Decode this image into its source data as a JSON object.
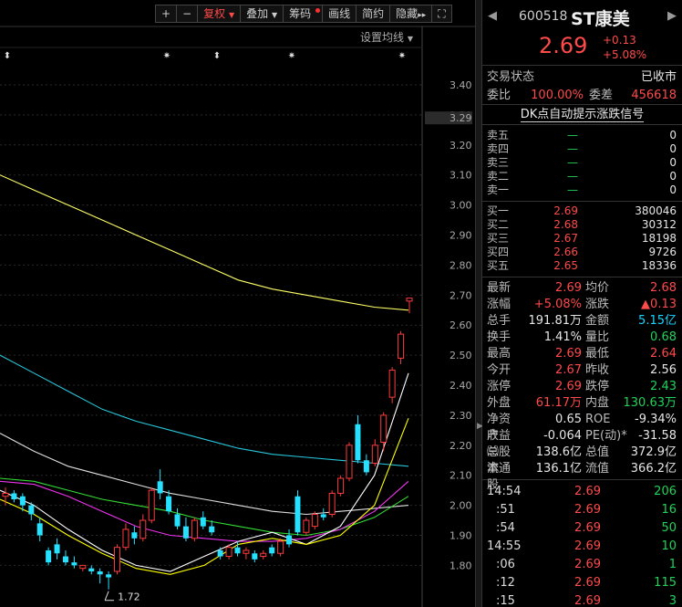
{
  "toolbar": {
    "plus": "+",
    "minus": "−",
    "adjust": "复权",
    "overlay": "叠加",
    "chips": "筹码",
    "draw": "画线",
    "simple": "简约",
    "hide": "隐藏",
    "more": "▸▸",
    "fullscreen": "⛶"
  },
  "ma_setting": "设置均线",
  "chart_data": {
    "type": "candlestick",
    "y_ticks": [
      "3.40",
      "3.30",
      "3.20",
      "3.10",
      "3.00",
      "2.90",
      "2.80",
      "2.70",
      "2.60",
      "2.50",
      "2.40",
      "2.30",
      "2.20",
      "2.10",
      "2.00",
      "1.90",
      "1.80"
    ],
    "ylim": [
      1.75,
      3.45
    ],
    "current_price_label": "3.29",
    "low_label": "1.72",
    "candles": [
      {
        "o": 2.03,
        "h": 2.06,
        "l": 2.0,
        "c": 2.04
      },
      {
        "o": 2.04,
        "h": 2.05,
        "l": 2.01,
        "c": 2.02
      },
      {
        "o": 2.03,
        "h": 2.04,
        "l": 1.98,
        "c": 2.0
      },
      {
        "o": 2.0,
        "h": 2.01,
        "l": 1.95,
        "c": 1.97
      },
      {
        "o": 1.94,
        "h": 1.96,
        "l": 1.88,
        "c": 1.9
      },
      {
        "o": 1.85,
        "h": 1.86,
        "l": 1.8,
        "c": 1.81
      },
      {
        "o": 1.87,
        "h": 1.89,
        "l": 1.82,
        "c": 1.84
      },
      {
        "o": 1.83,
        "h": 1.85,
        "l": 1.8,
        "c": 1.81
      },
      {
        "o": 1.81,
        "h": 1.83,
        "l": 1.79,
        "c": 1.8
      },
      {
        "o": 1.79,
        "h": 1.8,
        "l": 1.78,
        "c": 1.8
      },
      {
        "o": 1.79,
        "h": 1.8,
        "l": 1.77,
        "c": 1.78
      },
      {
        "o": 1.78,
        "h": 1.79,
        "l": 1.74,
        "c": 1.77
      },
      {
        "o": 1.77,
        "h": 1.78,
        "l": 1.72,
        "c": 1.76
      },
      {
        "o": 1.78,
        "h": 1.87,
        "l": 1.77,
        "c": 1.86
      },
      {
        "o": 1.86,
        "h": 1.94,
        "l": 1.85,
        "c": 1.92
      },
      {
        "o": 1.91,
        "h": 1.93,
        "l": 1.87,
        "c": 1.89
      },
      {
        "o": 1.89,
        "h": 1.97,
        "l": 1.88,
        "c": 1.95
      },
      {
        "o": 1.95,
        "h": 2.06,
        "l": 1.94,
        "c": 2.05
      },
      {
        "o": 2.08,
        "h": 2.12,
        "l": 2.02,
        "c": 2.04
      },
      {
        "o": 2.03,
        "h": 2.05,
        "l": 1.97,
        "c": 1.98
      },
      {
        "o": 1.97,
        "h": 1.99,
        "l": 1.92,
        "c": 1.93
      },
      {
        "o": 1.93,
        "h": 1.96,
        "l": 1.88,
        "c": 1.89
      },
      {
        "o": 1.89,
        "h": 1.96,
        "l": 1.88,
        "c": 1.95
      },
      {
        "o": 1.96,
        "h": 1.98,
        "l": 1.92,
        "c": 1.93
      },
      {
        "o": 1.93,
        "h": 1.95,
        "l": 1.9,
        "c": 1.91
      },
      {
        "o": 1.85,
        "h": 1.86,
        "l": 1.82,
        "c": 1.83
      },
      {
        "o": 1.83,
        "h": 1.87,
        "l": 1.82,
        "c": 1.86
      },
      {
        "o": 1.86,
        "h": 1.88,
        "l": 1.83,
        "c": 1.84
      },
      {
        "o": 1.84,
        "h": 1.86,
        "l": 1.82,
        "c": 1.85
      },
      {
        "o": 1.84,
        "h": 1.85,
        "l": 1.81,
        "c": 1.82
      },
      {
        "o": 1.83,
        "h": 1.85,
        "l": 1.82,
        "c": 1.84
      },
      {
        "o": 1.86,
        "h": 1.87,
        "l": 1.83,
        "c": 1.84
      },
      {
        "o": 1.84,
        "h": 1.89,
        "l": 1.83,
        "c": 1.88
      },
      {
        "o": 1.9,
        "h": 1.92,
        "l": 1.86,
        "c": 1.87
      },
      {
        "o": 2.03,
        "h": 2.05,
        "l": 1.9,
        "c": 1.91
      },
      {
        "o": 1.91,
        "h": 1.96,
        "l": 1.9,
        "c": 1.95
      },
      {
        "o": 1.93,
        "h": 1.98,
        "l": 1.92,
        "c": 1.97
      },
      {
        "o": 1.97,
        "h": 1.99,
        "l": 1.95,
        "c": 1.96
      },
      {
        "o": 1.97,
        "h": 2.05,
        "l": 1.96,
        "c": 2.04
      },
      {
        "o": 2.04,
        "h": 2.1,
        "l": 2.03,
        "c": 2.09
      },
      {
        "o": 2.09,
        "h": 2.21,
        "l": 2.08,
        "c": 2.2
      },
      {
        "o": 2.27,
        "h": 2.3,
        "l": 2.14,
        "c": 2.15
      },
      {
        "o": 2.15,
        "h": 2.17,
        "l": 2.1,
        "c": 2.11
      },
      {
        "o": 2.14,
        "h": 2.22,
        "l": 2.13,
        "c": 2.2
      },
      {
        "o": 2.21,
        "h": 2.31,
        "l": 2.18,
        "c": 2.3
      },
      {
        "o": 2.36,
        "h": 2.46,
        "l": 2.34,
        "c": 2.45
      },
      {
        "o": 2.49,
        "h": 2.58,
        "l": 2.47,
        "c": 2.57
      },
      {
        "o": 2.68,
        "h": 2.69,
        "l": 2.64,
        "c": 2.69
      }
    ],
    "ma_series": [
      {
        "color": "#ffff66",
        "values": [
          3.1,
          3.05,
          3.0,
          2.95,
          2.9,
          2.85,
          2.8,
          2.75,
          2.72,
          2.7,
          2.68,
          2.66,
          2.65
        ]
      },
      {
        "color": "#26c6da",
        "values": [
          2.5,
          2.44,
          2.38,
          2.32,
          2.28,
          2.25,
          2.22,
          2.19,
          2.17,
          2.16,
          2.15,
          2.14,
          2.13
        ]
      },
      {
        "color": "#e0e0e0",
        "values": [
          2.24,
          2.18,
          2.13,
          2.1,
          2.07,
          2.04,
          2.02,
          2.0,
          1.98,
          1.97,
          1.98,
          1.99,
          2.0
        ]
      },
      {
        "color": "#33dd33",
        "values": [
          2.09,
          2.08,
          2.05,
          2.02,
          2.0,
          1.98,
          1.95,
          1.93,
          1.91,
          1.9,
          1.92,
          1.96,
          2.03
        ]
      },
      {
        "color": "#ee33ee",
        "values": [
          2.08,
          2.07,
          2.03,
          1.98,
          1.93,
          1.9,
          1.89,
          1.88,
          1.88,
          1.89,
          1.92,
          1.98,
          2.08
        ]
      },
      {
        "color": "#ffffff",
        "values": [
          2.05,
          2.0,
          1.92,
          1.85,
          1.8,
          1.78,
          1.83,
          1.88,
          1.91,
          1.87,
          1.93,
          2.1,
          2.44
        ]
      },
      {
        "color": "#ffff00",
        "values": [
          2.02,
          1.97,
          1.9,
          1.84,
          1.79,
          1.77,
          1.8,
          1.87,
          1.89,
          1.87,
          1.9,
          2.0,
          2.29
        ]
      }
    ],
    "markers": [
      "⬍",
      "✷",
      "⬍",
      "✷",
      "✷"
    ]
  },
  "header": {
    "nav_left": "◀",
    "nav_right": "▶",
    "code": "600518",
    "name": "ST康美",
    "price": "2.69",
    "change": "+0.13",
    "change_pct": "+5.08%"
  },
  "status": {
    "label": "交易状态",
    "value": "已收市"
  },
  "commission": {
    "ratio_label": "委比",
    "ratio_value": "100.00%",
    "diff_label": "委差",
    "diff_value": "456618"
  },
  "signal": "DK点自动提示涨跌信号",
  "asks": [
    {
      "label": "卖五",
      "price": "—",
      "vol": "0"
    },
    {
      "label": "卖四",
      "price": "—",
      "vol": "0"
    },
    {
      "label": "卖三",
      "price": "—",
      "vol": "0"
    },
    {
      "label": "卖二",
      "price": "—",
      "vol": "0"
    },
    {
      "label": "卖一",
      "price": "—",
      "vol": "0"
    }
  ],
  "bids": [
    {
      "label": "买一",
      "price": "2.69",
      "vol": "380046"
    },
    {
      "label": "买二",
      "price": "2.68",
      "vol": "30312"
    },
    {
      "label": "买三",
      "price": "2.67",
      "vol": "18198"
    },
    {
      "label": "买四",
      "price": "2.66",
      "vol": "9726"
    },
    {
      "label": "买五",
      "price": "2.65",
      "vol": "18336"
    }
  ],
  "quotes": [
    {
      "l1": "最新",
      "v1": "2.69",
      "c1": "red",
      "l2": "均价",
      "v2": "2.68",
      "c2": "red"
    },
    {
      "l1": "涨幅",
      "v1": "+5.08%",
      "c1": "red",
      "l2": "涨跌",
      "v2": "▲0.13",
      "c2": "red"
    },
    {
      "l1": "总手",
      "v1": "191.81万",
      "c1": "white",
      "l2": "金额",
      "v2": "5.15亿",
      "c2": "cyan"
    },
    {
      "l1": "换手",
      "v1": "1.41%",
      "c1": "white",
      "l2": "量比",
      "v2": "0.68",
      "c2": "green"
    },
    {
      "l1": "最高",
      "v1": "2.69",
      "c1": "red",
      "l2": "最低",
      "v2": "2.64",
      "c2": "red"
    },
    {
      "l1": "今开",
      "v1": "2.67",
      "c1": "red",
      "l2": "昨收",
      "v2": "2.56",
      "c2": "white"
    },
    {
      "l1": "涨停",
      "v1": "2.69",
      "c1": "red",
      "l2": "跌停",
      "v2": "2.43",
      "c2": "green"
    },
    {
      "l1": "外盘",
      "v1": "61.17万",
      "c1": "red",
      "l2": "内盘",
      "v2": "130.63万",
      "c2": "green"
    },
    {
      "l1": "净资产",
      "v1": "0.65",
      "c1": "white",
      "l2": "ROE",
      "v2": "-9.34%",
      "c2": "white"
    },
    {
      "l1": "收益㈢",
      "v1": "-0.064",
      "c1": "white",
      "l2": "PE(动)*",
      "v2": "-31.58",
      "c2": "white"
    },
    {
      "l1": "总股本",
      "v1": "138.6亿",
      "c1": "white",
      "l2": "总值",
      "v2": "372.9亿",
      "c2": "white"
    },
    {
      "l1": "流通股",
      "v1": "136.1亿",
      "c1": "white",
      "l2": "流值",
      "v2": "366.2亿",
      "c2": "white"
    }
  ],
  "ticks": [
    {
      "t": "14:54",
      "p": "2.69",
      "v": "206",
      "c": "green"
    },
    {
      "t": ":51",
      "p": "2.69",
      "v": "16",
      "c": "green"
    },
    {
      "t": ":54",
      "p": "2.69",
      "v": "50",
      "c": "green"
    },
    {
      "t": "14:55",
      "p": "2.69",
      "v": "10",
      "c": "green"
    },
    {
      "t": ":06",
      "p": "2.69",
      "v": "1",
      "c": "green"
    },
    {
      "t": ":12",
      "p": "2.69",
      "v": "115",
      "c": "green"
    },
    {
      "t": ":15",
      "p": "2.69",
      "v": "3",
      "c": "green"
    }
  ]
}
